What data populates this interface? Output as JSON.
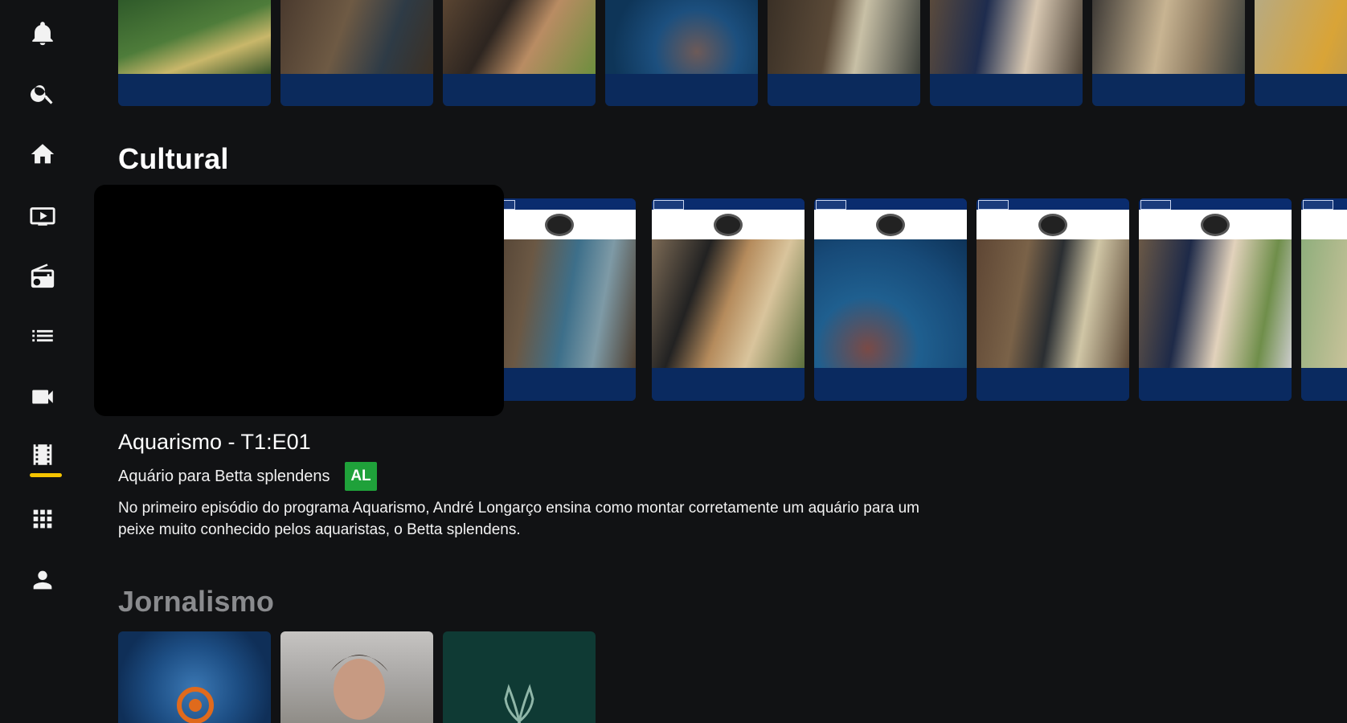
{
  "sidebar": {
    "items": [
      {
        "name": "notifications",
        "icon": "bell-icon",
        "active": false
      },
      {
        "name": "search",
        "icon": "search-icon",
        "active": false
      },
      {
        "name": "home",
        "icon": "home-icon",
        "active": false
      },
      {
        "name": "tv",
        "icon": "tv-icon",
        "active": false
      },
      {
        "name": "radio",
        "icon": "radio-icon",
        "active": false
      },
      {
        "name": "list",
        "icon": "list-icon",
        "active": false
      },
      {
        "name": "video",
        "icon": "video-camera-icon",
        "active": false
      },
      {
        "name": "movies",
        "icon": "film-icon",
        "active": true
      },
      {
        "name": "apps",
        "icon": "grid-icon",
        "active": false
      },
      {
        "name": "profile",
        "icon": "person-icon",
        "active": false
      }
    ]
  },
  "sections": {
    "cultural_title": "Cultural",
    "jornalismo_title": "Jornalismo"
  },
  "featured": {
    "title": "Aquarismo - T1:E01",
    "subtitle": "Aquário para Betta splendens",
    "rating": "AL",
    "description": "No primeiro episódio do programa Aquarismo, André Longarço ensina como montar corretamente um aquário para um peixe muito conhecido pelos aquaristas, o Betta splendens."
  },
  "colors": {
    "background": "#111214",
    "accent": "#f5c400",
    "rating_green": "#1fa13a",
    "card_blue": "#0b2a5c"
  }
}
